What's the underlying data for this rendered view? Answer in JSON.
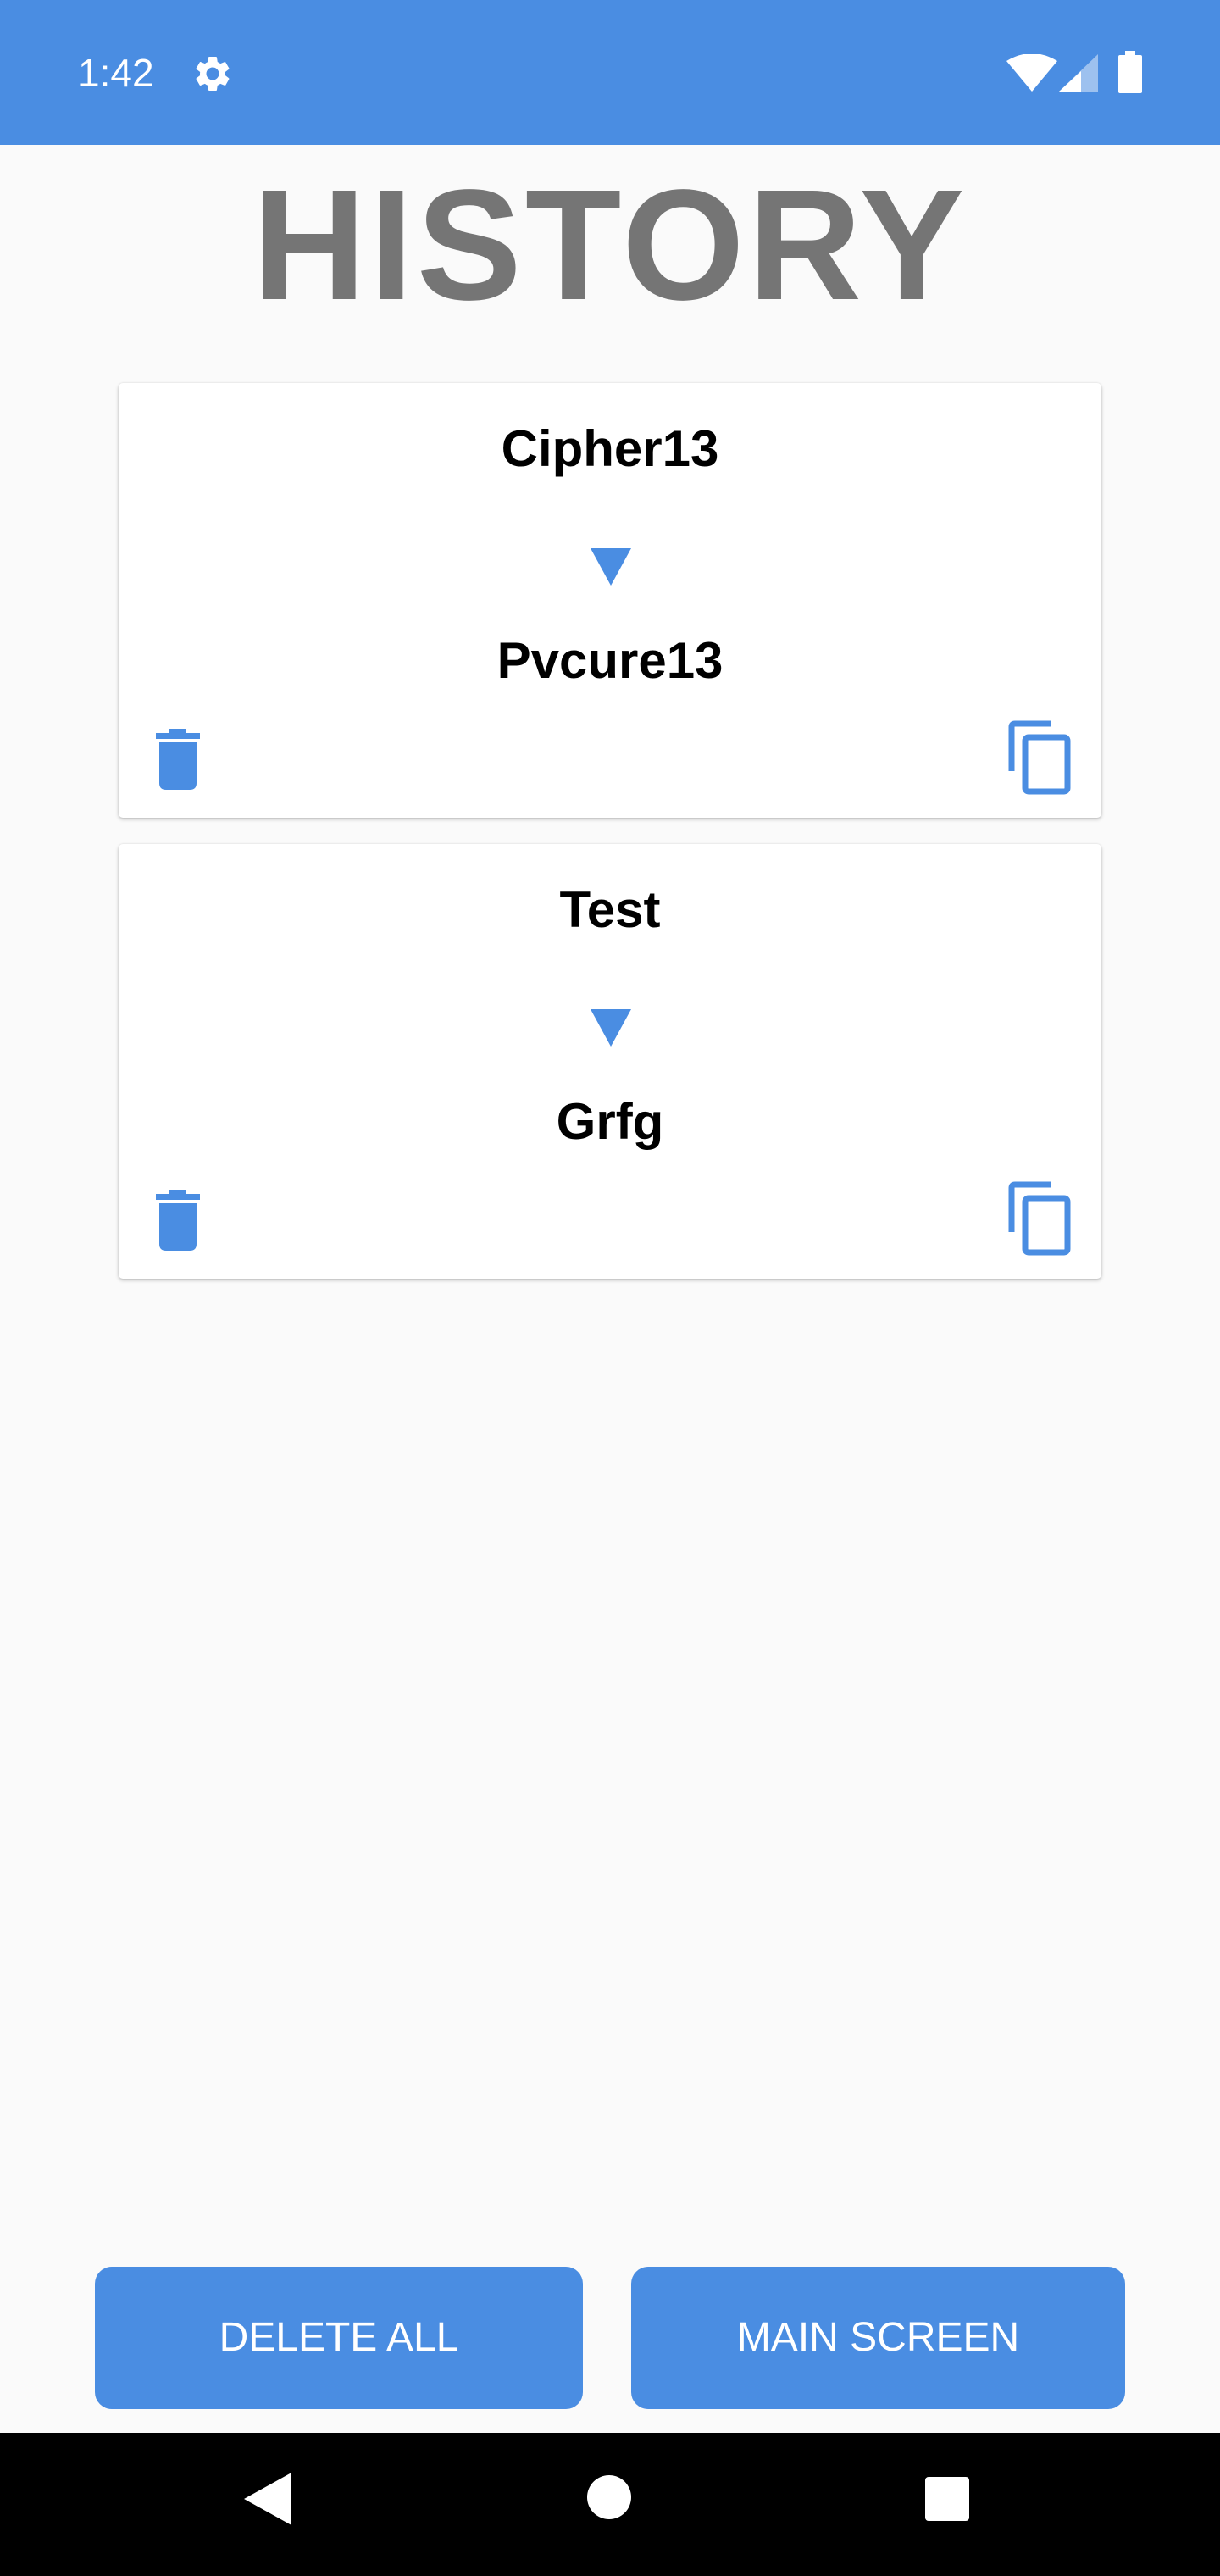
{
  "status_bar": {
    "time": "1:42",
    "icons": [
      "gear-icon",
      "wifi-icon",
      "cell-signal-icon",
      "battery-icon"
    ],
    "background_color": "#4a8de2"
  },
  "page": {
    "title": "HISTORY"
  },
  "history": [
    {
      "input": "Cipher13",
      "output": "Pvcure13"
    },
    {
      "input": "Test",
      "output": "Grfg"
    }
  ],
  "card_icons": {
    "arrow": "arrow-down-icon",
    "delete": "trash-icon",
    "copy": "copy-icon"
  },
  "buttons": {
    "delete_all": "DELETE ALL",
    "main_screen": "MAIN SCREEN"
  },
  "nav_bar": {
    "icons": [
      "back-icon",
      "home-icon",
      "recents-icon"
    ]
  },
  "colors": {
    "accent": "#4a8de2",
    "title": "#757575",
    "background": "#fafafa"
  }
}
